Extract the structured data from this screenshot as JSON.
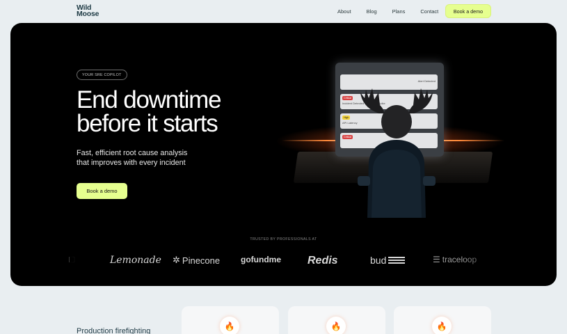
{
  "nav": {
    "logo_line1": "Wild",
    "logo_line2": "Moose",
    "links": [
      "About",
      "Blog",
      "Plans",
      "Contact"
    ],
    "cta": "Book a demo"
  },
  "hero": {
    "badge": "YOUR SRE COPILOT",
    "headline_line1": "End downtime",
    "headline_line2": "before it starts",
    "subhead_line1": "Fast, efficient root cause analysis",
    "subhead_line2": "that improves with every incident",
    "cta": "Book a demo",
    "trusted_label": "TRUSTED BY PROFESSIONALS AT",
    "brands": [
      "Lemonade",
      "Pinecone",
      "gofundme",
      "Redis",
      "bud",
      "traceloop"
    ]
  },
  "illustration": {
    "alerts": [
      {
        "tag": "",
        "text": "Alert Detected"
      },
      {
        "tag": "Critical",
        "text": "Incident Detected - Buffering Spike"
      },
      {
        "tag": "High",
        "text": "API Latency"
      },
      {
        "tag": "Critical",
        "text": ""
      }
    ]
  },
  "features": {
    "title": "Production firefighting"
  },
  "colors": {
    "accent": "#e6ff8f",
    "hero_bg": "#000000",
    "page_bg": "#e9eef1",
    "glow": "#ff8a3a"
  }
}
